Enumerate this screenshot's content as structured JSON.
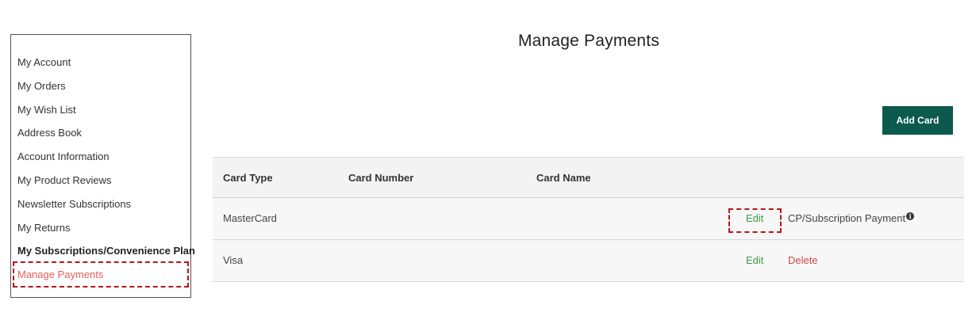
{
  "sidebar": {
    "items": [
      {
        "label": "My Account"
      },
      {
        "label": "My Orders"
      },
      {
        "label": "My Wish List"
      },
      {
        "label": "Address Book"
      },
      {
        "label": "Account Information"
      },
      {
        "label": "My Product Reviews"
      },
      {
        "label": "Newsletter Subscriptions"
      },
      {
        "label": "My Returns"
      },
      {
        "label": "My Subscriptions/Convenience Plan"
      },
      {
        "label": "Manage Payments"
      }
    ]
  },
  "page": {
    "title": "Manage Payments",
    "add_card_label": "Add Card"
  },
  "table": {
    "headers": [
      "Card Type",
      "Card Number",
      "Card Name"
    ],
    "rows": [
      {
        "card_type": "MasterCard",
        "card_number": "",
        "card_name": "",
        "edit_label": "Edit",
        "note": "CP/Subscription Payment"
      },
      {
        "card_type": "Visa",
        "card_number": "",
        "card_name": "",
        "edit_label": "Edit",
        "delete_label": "Delete"
      }
    ]
  },
  "icons": {
    "info": "info-icon"
  },
  "colors": {
    "brand_green": "#0b5a4d",
    "edit_link": "#3c9a4c",
    "delete_link": "#cc4747",
    "active_nav": "#e0605a",
    "highlight": "#b5161c"
  }
}
